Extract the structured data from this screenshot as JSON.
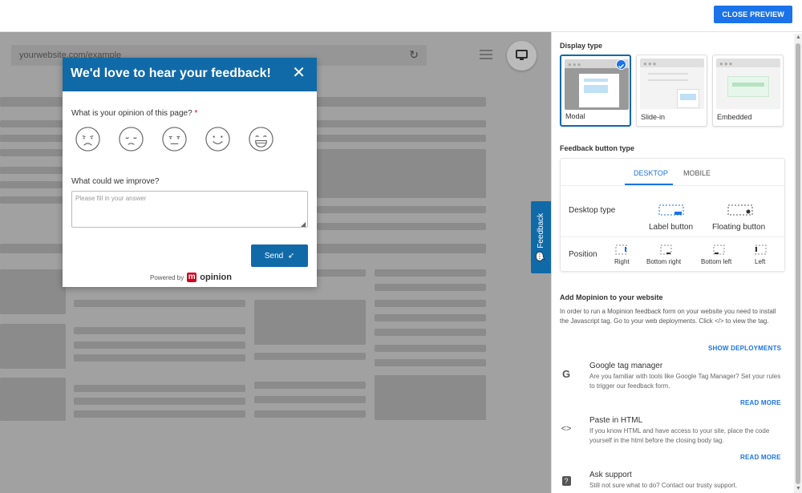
{
  "topbar": {
    "close_preview_label": "CLOSE PREVIEW"
  },
  "preview": {
    "url": "yourwebsite.com/example",
    "feedback_tab_label": "Feedback"
  },
  "modal": {
    "title": "We'd love to hear your feedback!",
    "question1": "What is your opinion of this page?",
    "required_mark": "*",
    "question2": "What could we improve?",
    "answer_placeholder": "Please fill in your answer",
    "send_label": "Send",
    "powered_by": "Powered by",
    "logo_text": "opinion"
  },
  "panel": {
    "display_type_title": "Display type",
    "display_types": [
      {
        "label": "Modal",
        "selected": true
      },
      {
        "label": "Slide-in",
        "selected": false
      },
      {
        "label": "Embedded",
        "selected": false
      }
    ],
    "feedback_button_type_title": "Feedback button type",
    "tabs": [
      {
        "label": "DESKTOP",
        "active": true
      },
      {
        "label": "MOBILE",
        "active": false
      }
    ],
    "desktop_type_label": "Desktop type",
    "desktop_type_options": [
      "Label button",
      "Floating button"
    ],
    "position_label": "Position",
    "position_options": [
      "Right",
      "Bottom right",
      "Bottom left",
      "Left"
    ],
    "add_title": "Add Mopinion to your website",
    "add_text": "In order to run a Mopinion feedback form on your website you need to install the Javascript tag. Go to your web deployments. Click </> to view the tag.",
    "show_deployments": "SHOW DEPLOYMENTS",
    "items": [
      {
        "icon": "google-icon",
        "title": "Google tag manager",
        "desc": "Are you familiar with tools like Google Tag Manager? Set your rules to trigger our feedback form.",
        "link": "READ MORE"
      },
      {
        "icon": "code-icon",
        "title": "Paste in HTML",
        "desc": "If you know HTML and have access to your site, place the code yourself in the html before the closing body tag.",
        "link": "READ MORE"
      },
      {
        "icon": "help-icon",
        "title": "Ask support",
        "desc": "Still not sure what to do? Contact our trusty support."
      }
    ]
  },
  "colors": {
    "brand_blue": "#116aa8",
    "accent_blue": "#1a73e8",
    "logo_red": "#d0021b"
  }
}
